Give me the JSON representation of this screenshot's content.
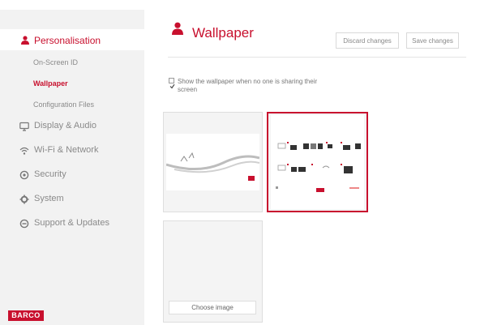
{
  "sidebar": {
    "active_section": "Personalisation",
    "subitems": [
      "On-Screen ID",
      "Wallpaper",
      "Configuration Files"
    ],
    "active_subitem": "Wallpaper",
    "items": [
      {
        "label": "Display & Audio",
        "icon": "monitor-icon"
      },
      {
        "label": "Wi-Fi & Network",
        "icon": "wifi-icon"
      },
      {
        "label": "Security",
        "icon": "shield-icon"
      },
      {
        "label": "System",
        "icon": "gear-icon"
      },
      {
        "label": "Support & Updates",
        "icon": "refresh-icon"
      }
    ],
    "logo": "BARCO"
  },
  "header": {
    "title": "Wallpaper",
    "discard_label": "Discard changes",
    "save_label": "Save changes"
  },
  "options": {
    "show_wallpaper_label": "Show the wallpaper when no one is sharing their screen",
    "show_wallpaper_checked": true
  },
  "gallery": {
    "choose_image_label": "Choose image",
    "selected_index": 1
  },
  "colors": {
    "accent": "#c8102e",
    "sidebar_bg": "#f2f2f2"
  }
}
